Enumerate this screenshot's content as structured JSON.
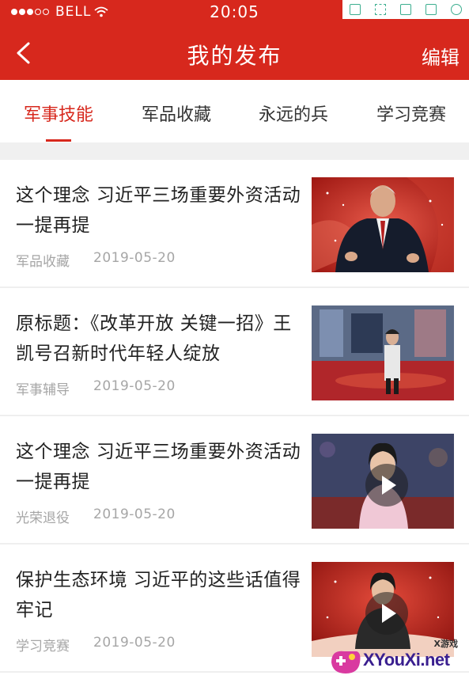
{
  "status_bar": {
    "carrier": "BELL",
    "time": "20:05"
  },
  "nav": {
    "title": "我的发布",
    "edit_label": "编辑"
  },
  "tabs": [
    {
      "label": "军事技能",
      "active": true
    },
    {
      "label": "军品收藏",
      "active": false
    },
    {
      "label": "永远的兵",
      "active": false
    },
    {
      "label": "学习竞赛",
      "active": false
    }
  ],
  "items": [
    {
      "title": "这个理念 习近平三场重要外资活动一提再提",
      "category": "军品收藏",
      "date": "2019-05-20",
      "is_video": false
    },
    {
      "title": "原标题：《改革开放 关键一招》王凯号召新时代年轻人绽放",
      "category": "军事辅导",
      "date": "2019-05-20",
      "is_video": false
    },
    {
      "title": "这个理念 习近平三场重要外资活动一提再提",
      "category": "光荣退役",
      "date": "2019-05-20",
      "is_video": true
    },
    {
      "title": "保护生态环境 习近平的这些话值得牢记",
      "category": "学习竞赛",
      "date": "2019-05-20",
      "is_video": true
    }
  ],
  "watermark": {
    "small": "X游戏",
    "main": "XYouXi.net"
  },
  "colors": {
    "brand_red": "#d7281d",
    "text_dark": "#222222",
    "text_meta": "#a6a6a6",
    "separator": "#f0f0f0"
  }
}
